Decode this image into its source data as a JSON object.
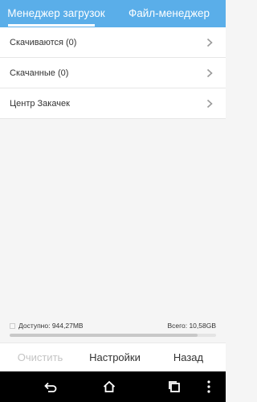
{
  "tabs": [
    {
      "label": "Менеджер загрузок",
      "active": true
    },
    {
      "label": "Файл-менеджер",
      "active": false
    }
  ],
  "list": {
    "items": [
      {
        "label": "Скачиваются (0)"
      },
      {
        "label": "Скачанные (0)"
      },
      {
        "label": "Центр Закачек"
      }
    ]
  },
  "storage": {
    "available": "Доступно: 944,27MB",
    "total": "Всего: 10,58GB",
    "used_fraction": 0.91
  },
  "actions": {
    "clear": "Очистить",
    "settings": "Настройки",
    "back": "Назад"
  },
  "navbar": {
    "icons": [
      "back-icon",
      "home-icon",
      "recents-icon",
      "more-icon"
    ]
  },
  "colors": {
    "accent": "#5aaee9",
    "disabled_text": "#c4c4c4"
  }
}
